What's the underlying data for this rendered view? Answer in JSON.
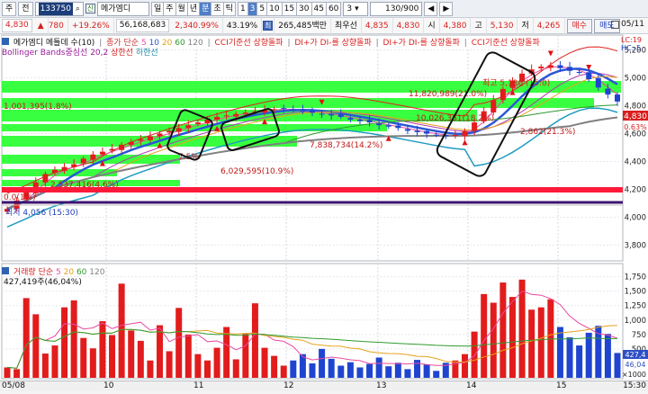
{
  "toolbar": {
    "buttons_left": [
      "주",
      "전"
    ],
    "code": "133750",
    "credit_label": "신",
    "stock_name": "메가엠디",
    "period_tabs": [
      "일",
      "주",
      "월",
      "년",
      "분",
      "초",
      "틱"
    ],
    "period_active": "분",
    "minute_options": [
      "1",
      "3",
      "5",
      "10",
      "15",
      "30",
      "45",
      "60"
    ],
    "minute_active": "3",
    "interval_value": "3",
    "count_display": "130/900"
  },
  "topright": {
    "date": "05/11"
  },
  "quote": {
    "price": "4,830",
    "change_arrow": "▲",
    "change": "780",
    "change_pct": "+19.26%",
    "volume": "56,168,683",
    "volume_ratio": "2,340.99%",
    "turnover": "43.19%",
    "best_label": "최",
    "amount": "265,485백만",
    "bid_label": "최우선",
    "best_ask": "4,835",
    "best_bid": "4,830",
    "open_label": "시",
    "open": "4,380",
    "high_label": "고",
    "high": "5,130",
    "low_label": "저",
    "low": "4,265",
    "buy_label": "매수",
    "sell_label": "매도"
  },
  "main_legend": {
    "title": "메가엠디 메틀데 수(10)",
    "ma_label": "종가 단순",
    "ma_periods": [
      "5",
      "10",
      "20",
      "60",
      "120"
    ],
    "ma_colors": [
      "#e84ba0",
      "#2c57d6",
      "#e5a21a",
      "#2f9a2f",
      "#808080"
    ],
    "indicator1": "CCI기준선 상향돌파",
    "indicator2": "DI+가 DI-를 상향돌파",
    "indicator3": "DI+가 DI-를 상향돌파",
    "indicator4": "CCI기준선 상향돌파",
    "bollinger": "Bollinger Bands중심선 20,2",
    "upper": "상한선",
    "lower": "하한선"
  },
  "corner": {
    "lc": "LC:19",
    "hc": "HC:-5"
  },
  "price_axis": {
    "ticks": [
      "5,200",
      "5,000",
      "4,800",
      "4,600",
      "4,400",
      "4,200",
      "4,000",
      "3,800"
    ],
    "current": "4,830",
    "current_pct": "0.63%"
  },
  "annotations": {
    "high_label": "최고 5,130 (15:0)",
    "low_label": "최저 4,056 (15:30)",
    "vol1": "11,820,989(21.0%)",
    "vol2": "10,026,361(18.2%)",
    "vol3": "7,838,734(14.2%)",
    "vol4": "6,029,595(10.9%)",
    "vol5": "1,001,395(1.8%)",
    "vol6": "2,537,416(4.6%)",
    "vol7": "2,862(21.3%)",
    "vol8": "7.5%",
    "vol9": "0.0(1%)"
  },
  "volume_legend": {
    "title": "거래량",
    "ma_label": "단순",
    "ma_periods": [
      "5",
      "20",
      "60",
      "120"
    ],
    "ma_colors": [
      "#e84ba0",
      "#e5a21a",
      "#2f9a2f",
      "#808080"
    ],
    "value": "427,419주(46,04%)"
  },
  "volume_axis": {
    "ticks": [
      "1,750",
      "1,500",
      "1,250",
      "1,000",
      "750",
      "500"
    ],
    "current": "427,4",
    "current2": "46,04",
    "unit": "×1000"
  },
  "dates": {
    "labels": [
      "05/08",
      "10",
      "11",
      "12",
      "13",
      "14",
      "15"
    ],
    "time": "15:30"
  },
  "chart_data": {
    "type": "candlestick",
    "price_range": [
      3700,
      5300
    ],
    "volume_range": [
      0,
      1900
    ],
    "interval": "3분",
    "close_series": [
      4060,
      4120,
      4180,
      4250,
      4310,
      4340,
      4360,
      4380,
      4420,
      4450,
      4470,
      4490,
      4520,
      4540,
      4560,
      4580,
      4600,
      4620,
      4640,
      4660,
      4680,
      4700,
      4720,
      4730,
      4740,
      4750,
      4760,
      4770,
      4775,
      4780,
      4770,
      4760,
      4750,
      4740,
      4730,
      4720,
      4700,
      4690,
      4680,
      4660,
      4650,
      4640,
      4620,
      4610,
      4600,
      4590,
      4580,
      4590,
      4620,
      4680,
      4760,
      4840,
      4920,
      4980,
      5030,
      5060,
      5080,
      5090,
      5070,
      5050,
      5040,
      4990,
      4930,
      4880,
      4830
    ],
    "volume_series": [
      180,
      150,
      1380,
      1100,
      420,
      560,
      1220,
      1340,
      690,
      510,
      980,
      740,
      1630,
      820,
      640,
      300,
      910,
      460,
      1210,
      750,
      410,
      300,
      520,
      880,
      320,
      760,
      1290,
      520,
      380,
      210,
      300,
      410,
      250,
      500,
      330,
      210,
      270,
      180,
      240,
      350,
      200,
      260,
      150,
      310,
      230,
      120,
      260,
      300,
      410,
      800,
      1450,
      1300,
      1650,
      1400,
      1700,
      1180,
      1220,
      1360,
      880,
      700,
      560,
      780,
      900,
      760,
      430
    ]
  }
}
